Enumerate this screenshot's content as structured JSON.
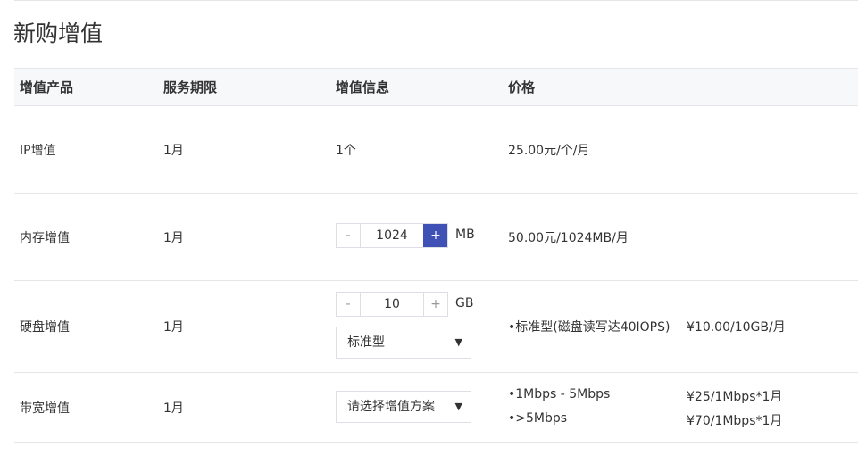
{
  "page": {
    "title": "新购增值"
  },
  "table": {
    "headers": [
      "增值产品",
      "服务期限",
      "增值信息",
      "价格"
    ],
    "rows": {
      "ip": {
        "product": "IP增值",
        "period": "1月",
        "info": "1个",
        "price": "25.00元/个/月"
      },
      "memory": {
        "product": "内存增值",
        "period": "1月",
        "stepper": {
          "minus": "-",
          "value": "1024",
          "plus": "+"
        },
        "unit": "MB",
        "price": "50.00元/1024MB/月"
      },
      "disk": {
        "product": "硬盘增值",
        "period": "1月",
        "stepper": {
          "minus": "-",
          "value": "10",
          "plus": "+"
        },
        "unit": "GB",
        "select_value": "标准型",
        "price_desc": "•标准型(磁盘读写达40IOPS)",
        "price_value": "¥10.00/10GB/月"
      },
      "bandwidth": {
        "product": "带宽增值",
        "period": "1月",
        "select_value": "请选择增值方案",
        "tiers": [
          {
            "range": "•1Mbps - 5Mbps",
            "price": "¥25/1Mbps*1月"
          },
          {
            "range": "•>5Mbps",
            "price": "¥70/1Mbps*1月"
          }
        ]
      }
    }
  },
  "icons": {
    "dropdown": "▼"
  },
  "colors": {
    "accent": "#3f51b5",
    "header_bg": "#f7f8fa",
    "border": "#e4e6ea"
  }
}
